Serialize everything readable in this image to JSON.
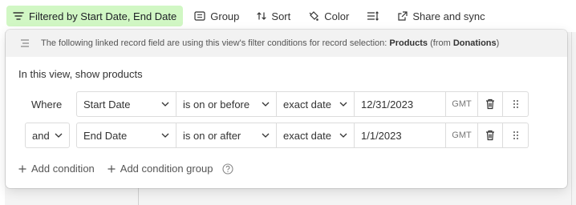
{
  "toolbar": {
    "filter_label": "Filtered by Start Date, End Date",
    "group_label": "Group",
    "sort_label": "Sort",
    "color_label": "Color",
    "share_label": "Share and sync"
  },
  "popover": {
    "notice_text": "The following linked record field are using this view's filter conditions for record selection: ",
    "notice_field": "Products",
    "notice_from_prefix": " (from ",
    "notice_table": "Donations",
    "notice_from_suffix": ")",
    "title": "In this view, show products",
    "conditions": [
      {
        "lead": "Where",
        "field": "Start Date",
        "operator": "is on or before",
        "mode": "exact date",
        "value": "12/31/2023",
        "tz": "GMT"
      },
      {
        "lead": "and",
        "field": "End Date",
        "operator": "is on or after",
        "mode": "exact date",
        "value": "1/1/2023",
        "tz": "GMT"
      }
    ],
    "add_condition": "Add condition",
    "add_condition_group": "Add condition group"
  },
  "colors": {
    "filter_active_bg": "#d1f7c4"
  },
  "icons": [
    "filter-icon",
    "group-icon",
    "sort-icon",
    "color-icon",
    "row-height-icon",
    "share-icon",
    "linked-fields-icon",
    "chevron-down-icon",
    "trash-icon",
    "drag-handle-icon",
    "plus-icon",
    "help-icon"
  ]
}
